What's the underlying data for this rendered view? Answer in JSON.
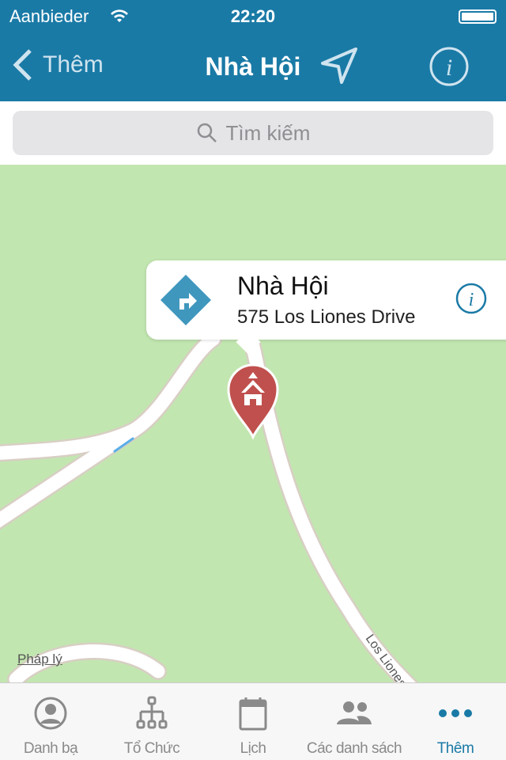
{
  "status": {
    "carrier": "Aanbieder",
    "time": "22:20"
  },
  "nav": {
    "back_label": "Thêm",
    "title": "Nhà Hội"
  },
  "search": {
    "placeholder": "Tìm kiếm"
  },
  "map": {
    "callout_name": "Nhà Hội",
    "callout_address": "575 Los Liones Drive",
    "street_label": "Los Liones",
    "legal_link": "Pháp lý"
  },
  "tabs": [
    {
      "label": "Danh bạ",
      "icon": "contact-icon"
    },
    {
      "label": "Tổ Chức",
      "icon": "org-chart-icon"
    },
    {
      "label": "Lịch",
      "icon": "calendar-icon"
    },
    {
      "label": "Các danh sách",
      "icon": "people-icon"
    },
    {
      "label": "Thêm",
      "icon": "more-icon",
      "active": true
    }
  ],
  "colors": {
    "accent": "#1a7aa6",
    "pin": "#c0504d",
    "map": "#c2e6b0"
  }
}
